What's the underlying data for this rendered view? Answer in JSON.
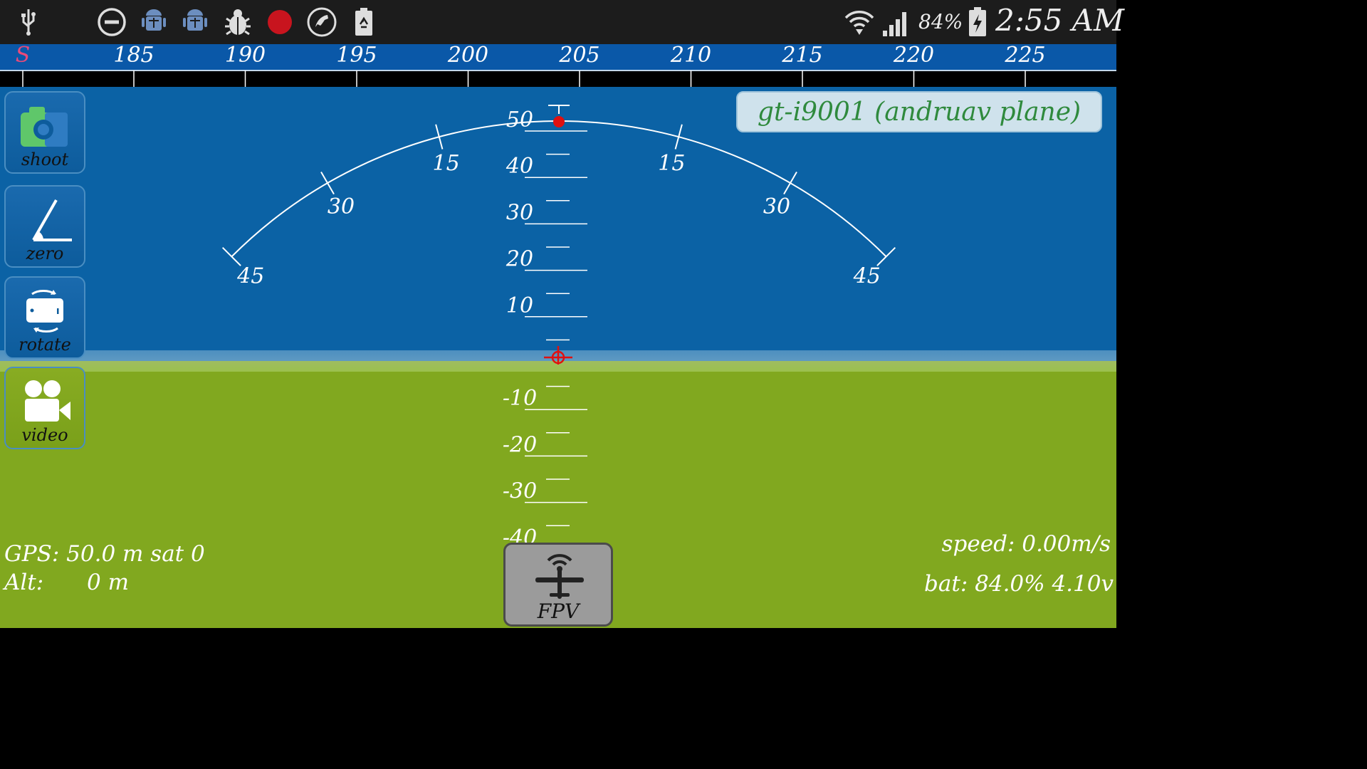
{
  "status_bar": {
    "battery_percent_text": "84%",
    "time": "2:55 AM",
    "icons_left": [
      "usb-icon",
      "do-not-disturb-icon",
      "android-debug-icon",
      "android-debug-icon",
      "bug-icon",
      "record-icon",
      "phone-icon",
      "recycle-battery-icon"
    ],
    "icons_right": [
      "wifi-icon",
      "signal-icon",
      "battery-charging-icon"
    ]
  },
  "compass": {
    "marker": "S",
    "ticks": [
      "185",
      "190",
      "195",
      "200",
      "205",
      "210",
      "215",
      "220",
      "225"
    ]
  },
  "attitude": {
    "pitch_labels": [
      "50",
      "40",
      "30",
      "20",
      "10",
      "-10",
      "-20",
      "-30",
      "-40"
    ],
    "roll_labels_left": [
      "45",
      "30",
      "15"
    ],
    "roll_labels_right": [
      "15",
      "30",
      "45"
    ]
  },
  "side_buttons": [
    {
      "id": "shoot",
      "label": "shoot"
    },
    {
      "id": "zero",
      "label": "zero"
    },
    {
      "id": "rotate",
      "label": "rotate"
    },
    {
      "id": "video",
      "label": "video"
    }
  ],
  "device_name": "gt-i9001 (andruav plane)",
  "telemetry": {
    "gps": "GPS:  50.0 m sat 0",
    "alt_label": "Alt:",
    "alt_value": "0 m",
    "speed": "speed: 0.00m/s",
    "battery": "bat: 84.0% 4.10v"
  },
  "fpv_label": "FPV",
  "colors": {
    "sky": "#0b62a5",
    "ground": "#81a81f",
    "compass_bar": "#0a58a8",
    "device_name_text": "#2f8a3d",
    "target_red": "#e01010"
  }
}
